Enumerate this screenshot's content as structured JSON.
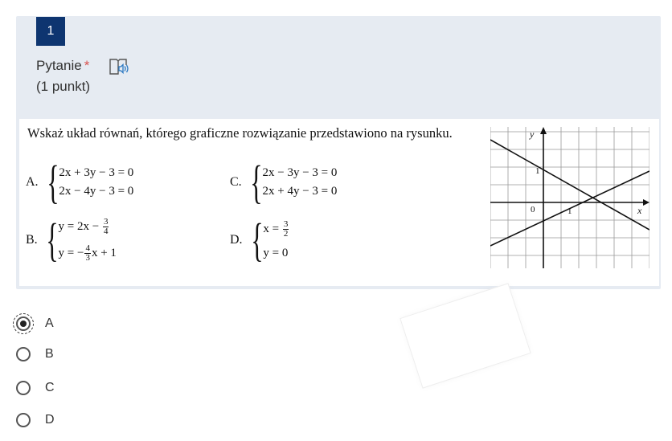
{
  "question": {
    "number": "1",
    "title": "Pytanie",
    "required_mark": "*",
    "points": "(1 punkt)",
    "text": "Wskaż układ równań, którego graficzne rozwiązanie przedstawiono na rysunku.",
    "options": {
      "A": {
        "letter": "A.",
        "line1": "2x + 3y − 3 = 0",
        "line2": "2x − 4y − 3 = 0"
      },
      "B": {
        "letter": "B.",
        "line1_pre": "y = 2x − ",
        "line1_num": "3",
        "line1_den": "4",
        "line2_pre": "y = −",
        "line2_num": "4",
        "line2_den": "3",
        "line2_post": "x + 1"
      },
      "C": {
        "letter": "C.",
        "line1": "2x − 3y − 3 = 0",
        "line2": "2x + 4y − 3 = 0"
      },
      "D": {
        "letter": "D.",
        "line1_pre": "x = ",
        "line1_num": "3",
        "line1_den": "2",
        "line2": "y = 0"
      }
    },
    "graph": {
      "y_label": "y",
      "x_label": "x",
      "origin_label": "0",
      "one_y": "1",
      "one_x": "1"
    }
  },
  "answers": [
    {
      "label": "A",
      "selected": true
    },
    {
      "label": "B",
      "selected": false
    },
    {
      "label": "C",
      "selected": false
    },
    {
      "label": "D",
      "selected": false
    }
  ],
  "icons": {
    "audio": "read-aloud-icon"
  },
  "colors": {
    "badge": "#0e3570",
    "card": "#e6ebf2",
    "required": "#d9534f"
  }
}
